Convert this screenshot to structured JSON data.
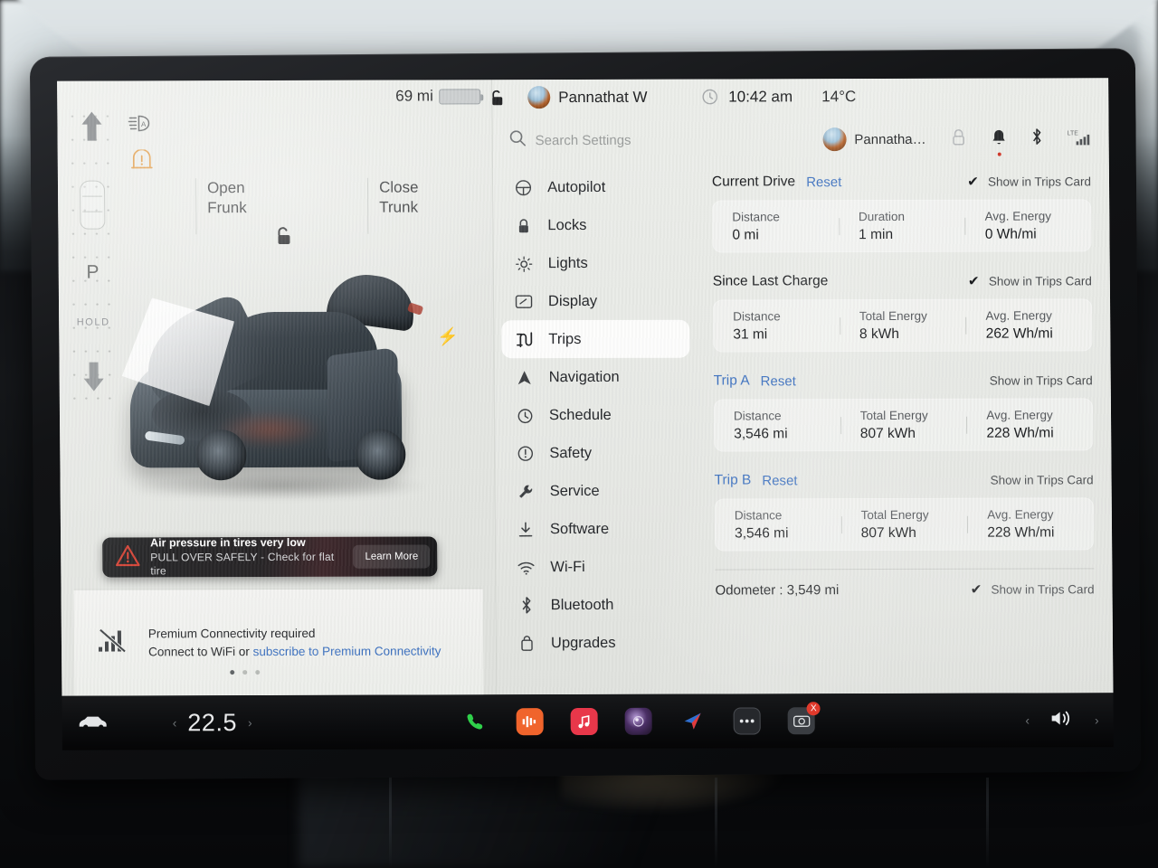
{
  "status_bar": {
    "range": "69 mi",
    "battery_percent": 22,
    "battery_color": "#f0a02a",
    "lock_icon": "unlock-icon",
    "driver_profile": "Pannathat W",
    "clock_icon": "clock-icon",
    "time": "10:42 am",
    "temperature": "14°C"
  },
  "left_pane": {
    "gear": {
      "selected": "P",
      "hold_label": "HOLD",
      "up_icon": "arrow-up-icon",
      "down_icon": "arrow-down-icon",
      "car_icon": "car-top-icon"
    },
    "indicators": {
      "headlight_auto": "headlight-auto-icon",
      "tpms": "tire-pressure-warning-icon"
    },
    "frunk": {
      "action": "Open",
      "target": "Frunk"
    },
    "trunk": {
      "action": "Close",
      "target": "Trunk"
    },
    "lock_state_icon": "lock-open-icon",
    "charge_port_icon": "charge-bolt-icon",
    "alert": {
      "icon": "warning-triangle-icon",
      "title": "Air pressure in tires very low",
      "subtitle": "PULL OVER SAFELY - Check for flat tire",
      "button": "Learn More",
      "accent": "#d1392b"
    },
    "premium": {
      "icon": "no-signal-icon",
      "line1": "Premium Connectivity required",
      "line2_prefix": "Connect to WiFi or ",
      "line2_link": "subscribe to Premium Connectivity",
      "link_color": "#3a6fbf"
    },
    "page_dots": {
      "count": 3,
      "active": 0
    }
  },
  "settings": {
    "search": {
      "icon": "search-icon",
      "placeholder": "Search Settings",
      "value": ""
    },
    "profile": {
      "name": "Pannatha…",
      "avatar": "user-avatar"
    },
    "tray_icons": [
      {
        "name": "car-lock-icon",
        "badge": false
      },
      {
        "name": "notification-bell-icon",
        "badge": true
      },
      {
        "name": "bluetooth-icon",
        "badge": false
      },
      {
        "name": "lte-signal-icon",
        "badge": false
      }
    ],
    "menu": [
      {
        "label": "Autopilot",
        "icon": "steering-wheel-icon",
        "active": false
      },
      {
        "label": "Locks",
        "icon": "lock-icon",
        "active": false
      },
      {
        "label": "Lights",
        "icon": "sun-light-icon",
        "active": false
      },
      {
        "label": "Display",
        "icon": "display-icon",
        "active": false
      },
      {
        "label": "Trips",
        "icon": "trips-road-icon",
        "active": true
      },
      {
        "label": "Navigation",
        "icon": "navigation-arrow-icon",
        "active": false
      },
      {
        "label": "Schedule",
        "icon": "schedule-clock-icon",
        "active": false
      },
      {
        "label": "Safety",
        "icon": "safety-alert-icon",
        "active": false
      },
      {
        "label": "Service",
        "icon": "wrench-icon",
        "active": false
      },
      {
        "label": "Software",
        "icon": "download-icon",
        "active": false
      },
      {
        "label": "Wi-Fi",
        "icon": "wifi-icon",
        "active": false
      },
      {
        "label": "Bluetooth",
        "icon": "bluetooth-icon",
        "active": false
      },
      {
        "label": "Upgrades",
        "icon": "upgrades-bag-icon",
        "active": false
      }
    ]
  },
  "trips": {
    "show_in_trips_card_label": "Show in Trips Card",
    "reset_label": "Reset",
    "sections": [
      {
        "title": "Current Drive",
        "has_reset": true,
        "title_is_link": false,
        "show_in_card": true,
        "cells": [
          {
            "label": "Distance",
            "value": "0 mi"
          },
          {
            "label": "Duration",
            "value": "1 min"
          },
          {
            "label": "Avg. Energy",
            "value": "0 Wh/mi"
          }
        ]
      },
      {
        "title": "Since Last Charge",
        "has_reset": false,
        "title_is_link": false,
        "show_in_card": true,
        "cells": [
          {
            "label": "Distance",
            "value": "31 mi"
          },
          {
            "label": "Total Energy",
            "value": "8 kWh"
          },
          {
            "label": "Avg. Energy",
            "value": "262 Wh/mi"
          }
        ]
      },
      {
        "title": "Trip A",
        "has_reset": true,
        "title_is_link": true,
        "show_in_card": false,
        "cells": [
          {
            "label": "Distance",
            "value": "3,546 mi"
          },
          {
            "label": "Total Energy",
            "value": "807 kWh"
          },
          {
            "label": "Avg. Energy",
            "value": "228 Wh/mi"
          }
        ]
      },
      {
        "title": "Trip B",
        "has_reset": true,
        "title_is_link": true,
        "show_in_card": false,
        "cells": [
          {
            "label": "Distance",
            "value": "3,546 mi"
          },
          {
            "label": "Total Energy",
            "value": "807 kWh"
          },
          {
            "label": "Avg. Energy",
            "value": "228 Wh/mi"
          }
        ]
      }
    ],
    "odometer": {
      "text": "Odometer :  3,549 mi",
      "show_in_card": true
    }
  },
  "app_bar": {
    "car_icon": "car-icon",
    "temperature": "22.5",
    "temp_down_icon": "chevron-left-icon",
    "temp_up_icon": "chevron-right-icon",
    "apps": [
      {
        "name": "phone-icon",
        "color": "#2fd04a",
        "badge": ""
      },
      {
        "name": "tuneln-icon",
        "color": "#f0642c",
        "badge": ""
      },
      {
        "name": "music-icon",
        "color": "#e8374a",
        "badge": ""
      },
      {
        "name": "camera-lens-icon",
        "color": "#3b2a4a",
        "badge": ""
      },
      {
        "name": "navigation-app-icon",
        "color": "#2f6fd0",
        "badge": ""
      },
      {
        "name": "more-apps-icon",
        "color": "#2b2d31",
        "badge": ""
      },
      {
        "name": "dashcam-icon",
        "color": "#3a3d42",
        "badge": "X"
      }
    ],
    "back_icon": "chevron-left-icon",
    "volume_icon": "volume-icon",
    "forward_icon": "chevron-right-icon"
  }
}
